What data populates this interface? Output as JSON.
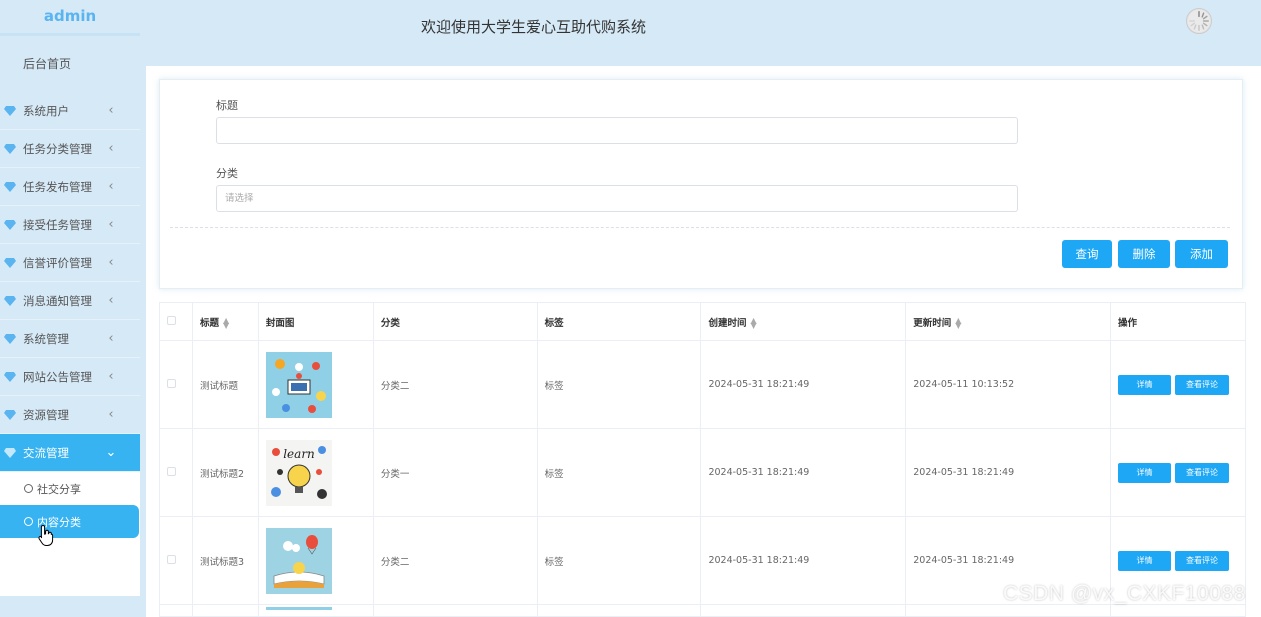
{
  "app": {
    "brand": "admin",
    "title": "欢迎使用大学生爱心互助代购系统"
  },
  "sidebar": {
    "home": "后台首页",
    "items": [
      {
        "label": "系统用户",
        "icon": "gem-icon"
      },
      {
        "label": "任务分类管理",
        "icon": "gem-icon"
      },
      {
        "label": "任务发布管理",
        "icon": "gem-icon"
      },
      {
        "label": "接受任务管理",
        "icon": "gem-icon"
      },
      {
        "label": "信誉评价管理",
        "icon": "gem-icon"
      },
      {
        "label": "消息通知管理",
        "icon": "gem-icon"
      },
      {
        "label": "系统管理",
        "icon": "gem-icon"
      },
      {
        "label": "网站公告管理",
        "icon": "gem-icon"
      },
      {
        "label": "资源管理",
        "icon": "gem-icon"
      },
      {
        "label": "交流管理",
        "icon": "gem-icon"
      }
    ],
    "sub_items": [
      {
        "label": "社交分享"
      },
      {
        "label": "内容分类"
      }
    ]
  },
  "search": {
    "title_label": "标题",
    "title_value": "",
    "category_label": "分类",
    "category_placeholder": "请选择",
    "query_label": "查询",
    "delete_label": "删除",
    "add_label": "添加"
  },
  "table": {
    "headers": [
      "标题",
      "封面图",
      "分类",
      "标签",
      "创建时间",
      "更新时间",
      "操作"
    ],
    "rows": [
      {
        "title": "测试标题",
        "category": "分类二",
        "tag": "标签",
        "created": "2024-05-31 18:21:49",
        "updated": "2024-05-11 10:13:52"
      },
      {
        "title": "测试标题2",
        "category": "分类一",
        "tag": "标签",
        "created": "2024-05-31 18:21:49",
        "updated": "2024-05-31 18:21:49"
      },
      {
        "title": "测试标题3",
        "category": "分类二",
        "tag": "标签",
        "created": "2024-05-31 18:21:49",
        "updated": "2024-05-31 18:21:49"
      }
    ],
    "detail_label": "详情",
    "comment_label": "查看评论"
  },
  "watermark": "CSDN @vx_CXKF10088",
  "colors": {
    "accent": "#1da7f5",
    "sidebar_bg": "#d6e9f7",
    "active": "#38b3f2"
  }
}
